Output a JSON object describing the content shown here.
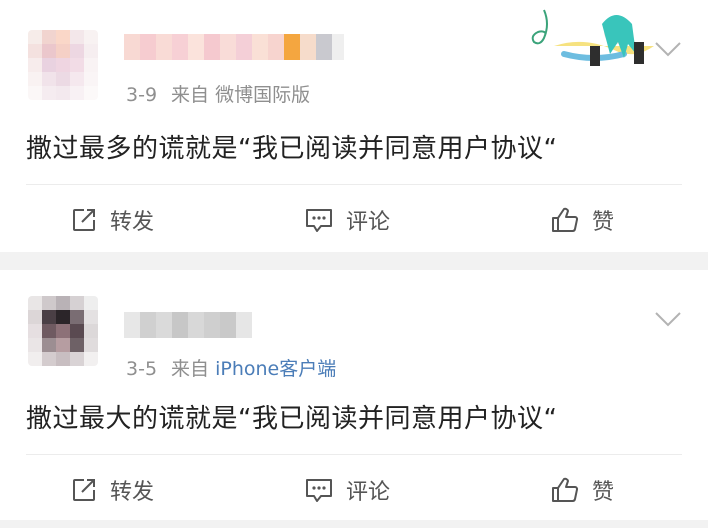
{
  "posts": [
    {
      "date": "3-9",
      "source_prefix": "来自",
      "source": "微博国际版",
      "text": "撒过最多的谎就是“我已阅读并同意用户协议“",
      "actions": {
        "repost": "转发",
        "comment": "评论",
        "like": "赞"
      }
    },
    {
      "date": "3-5",
      "source_prefix": "来自",
      "source": "iPhone客户端",
      "text": "撒过最大的谎就是“我已阅读并同意用户协议“",
      "actions": {
        "repost": "转发",
        "comment": "评论",
        "like": "赞"
      }
    }
  ],
  "colors": {
    "source_link": "#4b7db8",
    "meta": "#8f8f8f",
    "background": "#f2f2f2"
  },
  "icons": [
    "repost-icon",
    "comment-icon",
    "like-icon",
    "chevron-down-icon",
    "sticker-music-note",
    "avatar-blurred",
    "username-blurred"
  ]
}
